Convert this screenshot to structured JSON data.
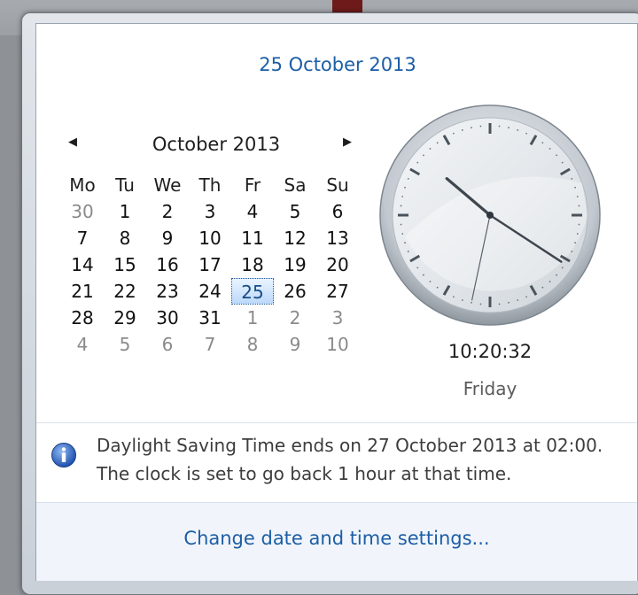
{
  "header": {
    "date_link": "25 October 2013"
  },
  "calendar": {
    "prev_glyph": "◀",
    "next_glyph": "▶",
    "month_title": "October 2013",
    "weekdays": [
      "Mo",
      "Tu",
      "We",
      "Th",
      "Fr",
      "Sa",
      "Su"
    ],
    "weeks": [
      [
        "30",
        "1",
        "2",
        "3",
        "4",
        "5",
        "6"
      ],
      [
        "7",
        "8",
        "9",
        "10",
        "11",
        "12",
        "13"
      ],
      [
        "14",
        "15",
        "16",
        "17",
        "18",
        "19",
        "20"
      ],
      [
        "21",
        "22",
        "23",
        "24",
        "25",
        "26",
        "27"
      ],
      [
        "28",
        "29",
        "30",
        "31",
        "1",
        "2",
        "3"
      ],
      [
        "4",
        "5",
        "6",
        "7",
        "8",
        "9",
        "10"
      ]
    ],
    "leading_other_month_count": 1,
    "trailing_other_month_count": 10,
    "selected_day": "25"
  },
  "clock": {
    "time": "10:20:32",
    "day": "Friday",
    "hours": 10,
    "minutes": 20,
    "seconds": 32
  },
  "info": {
    "icon": "info-icon",
    "line1": "Daylight Saving Time ends on 27 October 2013 at 02:00.",
    "line2": "The clock is set to go back 1 hour at that time."
  },
  "footer": {
    "settings_link": "Change date and time settings..."
  },
  "colors": {
    "link": "#1c5ea5",
    "selected_border": "#2c5f9a",
    "other_month": "#8a8a8a"
  }
}
